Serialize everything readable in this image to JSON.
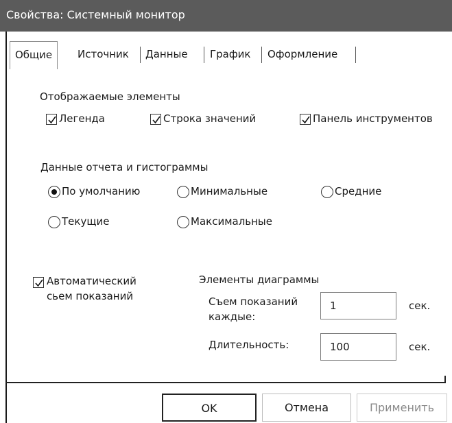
{
  "window": {
    "title": "Свойства: Системный монитор"
  },
  "tabs": [
    {
      "label": "Общие"
    },
    {
      "label": "Источник"
    },
    {
      "label": "Данные"
    },
    {
      "label": "График"
    },
    {
      "label": "Оформление"
    }
  ],
  "display_elements": {
    "heading": "Отображаемые элементы",
    "legend": {
      "label": "Легенда",
      "checked": true
    },
    "value_bar": {
      "label": "Строка значений",
      "checked": true
    },
    "toolbar": {
      "label": "Панель инструментов",
      "checked": true
    }
  },
  "report_data": {
    "heading": "Данные отчета и гистограммы",
    "default": {
      "label": "По умолчанию",
      "selected": true
    },
    "minimum": {
      "label": "Минимальные",
      "selected": false
    },
    "average": {
      "label": "Средние",
      "selected": false
    },
    "current": {
      "label": "Текущие",
      "selected": false
    },
    "maximum": {
      "label": "Максимальные",
      "selected": false
    }
  },
  "auto_sample": {
    "label_line1": "Автоматический",
    "label_line2": "сьем показаний",
    "checked": true
  },
  "graph_elements": {
    "heading": "Элементы диаграммы",
    "sample_every": {
      "label_line1": "Съем показаний",
      "label_line2": "каждые:",
      "value": "1",
      "unit": "сек."
    },
    "duration": {
      "label": "Длительность:",
      "value": "100",
      "unit": "сек."
    }
  },
  "buttons": {
    "ok": "OK",
    "cancel": "Отмена",
    "apply": "Применить"
  }
}
